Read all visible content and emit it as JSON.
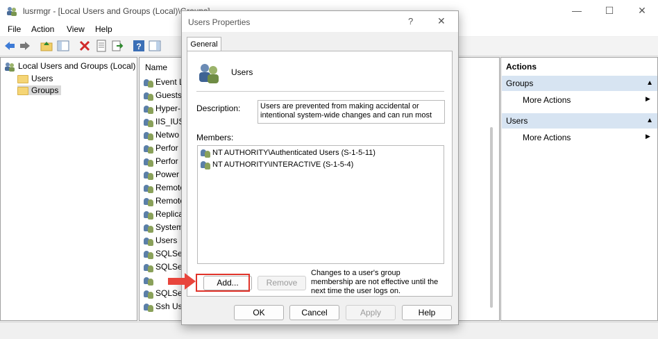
{
  "window": {
    "title": "lusrmgr - [Local Users and Groups (Local)\\Groups]",
    "minimize": "—",
    "maximize": "☐",
    "close": "✕"
  },
  "menu": [
    "File",
    "Action",
    "View",
    "Help"
  ],
  "tree": {
    "root": "Local Users and Groups (Local)",
    "users": "Users",
    "groups": "Groups"
  },
  "list": {
    "header_name": "Name",
    "rows": [
      "Event L",
      "Guests",
      "Hyper-",
      "IIS_IUSR",
      "Netwo",
      "Perfor",
      "Perfor",
      "Power",
      "Remote",
      "Remote",
      "Replica",
      "System",
      "Users",
      "SQLSer",
      "SQLSer",
      "",
      "SQLSer",
      "Ssh Use"
    ]
  },
  "actions": {
    "header": "Actions",
    "section1": "Groups",
    "section1_item": "More Actions",
    "section2": "Users",
    "section2_item": "More Actions"
  },
  "dialog": {
    "title": "Users Properties",
    "help_btn": "?",
    "close_btn": "✕",
    "tab": "General",
    "group_name": "Users",
    "description_label": "Description:",
    "description_value": "Users are prevented from making accidental or intentional system-wide changes and can run most",
    "members_label": "Members:",
    "members": [
      "NT AUTHORITY\\Authenticated Users (S-1-5-11)",
      "NT AUTHORITY\\INTERACTIVE (S-1-5-4)"
    ],
    "add_label": "Add...",
    "remove_label": "Remove",
    "note": "Changes to a user's group membership are not effective until the next time the user logs on.",
    "ok_label": "OK",
    "cancel_label": "Cancel",
    "apply_label": "Apply",
    "help_label": "Help"
  },
  "colors": {
    "accent_section": "#d7e4f2",
    "highlight_box": "#e0332a",
    "arrow": "#e8453c"
  }
}
